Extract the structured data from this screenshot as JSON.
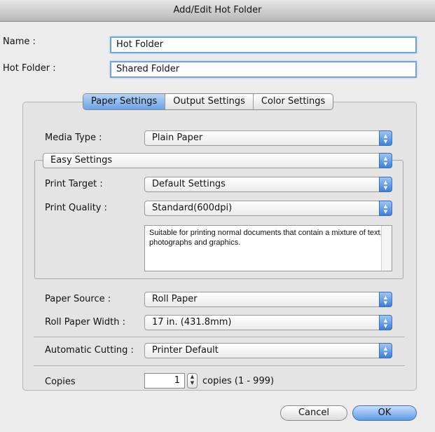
{
  "window": {
    "title": "Add/Edit Hot Folder"
  },
  "fields": {
    "name_label": "Name :",
    "name_value": "Hot Folder",
    "hotfolder_label": "Hot Folder :",
    "hotfolder_value": "Shared Folder"
  },
  "tabs": [
    {
      "label": "Paper Settings",
      "selected": true
    },
    {
      "label": "Output Settings",
      "selected": false
    },
    {
      "label": "Color Settings",
      "selected": false
    }
  ],
  "media_type": {
    "label": "Media Type :",
    "value": "Plain Paper"
  },
  "easy_settings": {
    "value": "Easy Settings"
  },
  "print_target": {
    "label": "Print Target :",
    "value": "Default Settings"
  },
  "print_quality": {
    "label": "Print Quality :",
    "value": "Standard(600dpi)"
  },
  "description": "Suitable for printing normal documents that contain a mixture of text, photographs and graphics.",
  "paper_source": {
    "label": "Paper Source :",
    "value": "Roll Paper"
  },
  "roll_width": {
    "label": "Roll Paper Width :",
    "value": "17 in. (431.8mm)"
  },
  "auto_cutting": {
    "label": "Automatic Cutting :",
    "value": "Printer Default"
  },
  "copies": {
    "label": "Copies",
    "value": "1",
    "suffix": "copies (1 - 999)"
  },
  "buttons": {
    "cancel": "Cancel",
    "ok": "OK"
  },
  "colors": {
    "accent": "#5d9ae8",
    "focus_ring": "#6fa2e0"
  }
}
